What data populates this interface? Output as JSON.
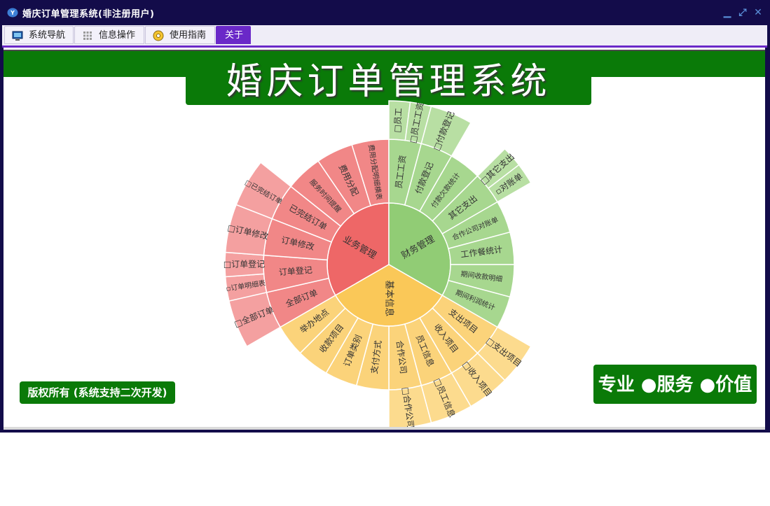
{
  "window": {
    "title": "婚庆订单管理系统(非注册用户)",
    "controls": {
      "minimize": "▁",
      "restore": "⤢",
      "close": "✕"
    }
  },
  "menu": {
    "tabs": [
      {
        "label": "系统导航",
        "icon": "monitor-icon"
      },
      {
        "label": "信息操作",
        "icon": "grid-icon"
      },
      {
        "label": "使用指南",
        "icon": "help-disc-icon"
      },
      {
        "label": "关于",
        "icon": ""
      }
    ],
    "active_tab": "关于"
  },
  "banner": {
    "title": "婚庆订单管理系统"
  },
  "footer": {
    "copyright": "版权所有 (系统支持二次开发)",
    "slogan": "专业 ●服务 ●价值"
  },
  "colors": {
    "title_bar": "#130c4a",
    "accent_purple": "#6a28c8",
    "brand_green": "#0a7a08",
    "sector_red": "#ee6767",
    "sector_green": "#91cc75",
    "sector_yellow": "#fac858"
  },
  "chart_data": {
    "type": "sunburst",
    "root": [
      {
        "name": "业务管理",
        "color": "#ee6767",
        "children": [
          {
            "name": "全部订单",
            "children": [
              {
                "name": "□全部订单"
              }
            ]
          },
          {
            "name": "订单登记",
            "children": [
              {
                "name": "▫订单明细表"
              },
              {
                "name": "□订单登记"
              }
            ]
          },
          {
            "name": "订单修改",
            "children": [
              {
                "name": "□订单修改"
              }
            ]
          },
          {
            "name": "已完结订单",
            "children": [
              {
                "name": "□已完结订单"
              }
            ]
          },
          {
            "name": "服务时间提醒"
          },
          {
            "name": "费用分配"
          },
          {
            "name": "费用分配明细横表"
          }
        ]
      },
      {
        "name": "财务管理",
        "color": "#91cc75",
        "children": [
          {
            "name": "员工工资",
            "children": [
              {
                "name": "□员工"
              },
              {
                "name": "□员工工资"
              }
            ]
          },
          {
            "name": "付款登记",
            "children": [
              {
                "name": "□付款登记"
              }
            ]
          },
          {
            "name": "付款欠款统计"
          },
          {
            "name": "其它支出",
            "children": [
              {
                "name": "□其它支出"
              },
              {
                "name": "▫对账单"
              }
            ]
          },
          {
            "name": "合作公司对账单"
          },
          {
            "name": "工作餐统计"
          },
          {
            "name": "期间收款明细"
          },
          {
            "name": "期间利润统计"
          }
        ]
      },
      {
        "name": "基本信息",
        "color": "#fac858",
        "children": [
          {
            "name": "支出项目",
            "children": [
              {
                "name": "□支出项目"
              }
            ]
          },
          {
            "name": "收入项目",
            "children": [
              {
                "name": "□收入项目"
              }
            ]
          },
          {
            "name": "员工信息",
            "children": [
              {
                "name": "□员工信息"
              }
            ]
          },
          {
            "name": "合作公司",
            "children": [
              {
                "name": "□合作公司"
              }
            ]
          },
          {
            "name": "支付方式"
          },
          {
            "name": "订单类别"
          },
          {
            "name": "收款项目"
          },
          {
            "name": "举办地点"
          }
        ]
      }
    ]
  }
}
